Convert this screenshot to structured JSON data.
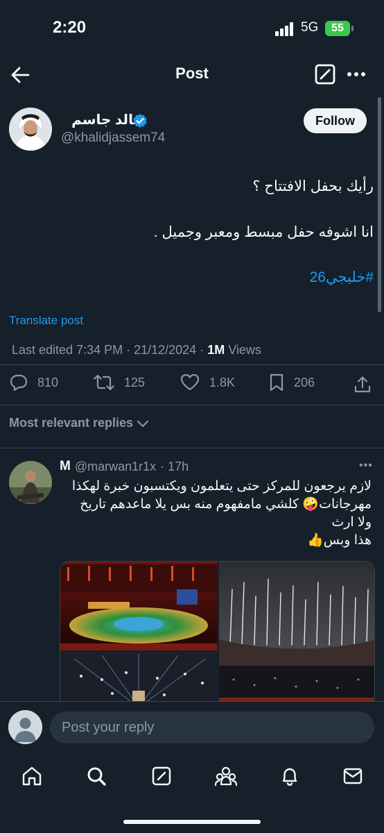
{
  "status": {
    "time": "2:20",
    "network": "5G",
    "battery": "55"
  },
  "header": {
    "title": "Post"
  },
  "author": {
    "name": "خالد جاسم",
    "handle": "@khalidjassem74",
    "follow_label": "Follow"
  },
  "post": {
    "line1": "رأيك بحفل الافتتاح ؟",
    "line2": "انا اشوفه حفل مبسط ومعبر وجميل .",
    "hashtag": "#خليجي26",
    "translate_label": "Translate post",
    "edited": "Last edited 7:34 PM · 21/12/2024 · ",
    "views_count": "1M",
    "views_label": " Views"
  },
  "actions": {
    "replies": "810",
    "reposts": "125",
    "likes": "1.8K",
    "bookmarks": "206"
  },
  "replies_filter": "Most relevant replies",
  "reply": {
    "name": "M",
    "handle": "@marwan1r1x",
    "time": "· 17h",
    "line1": "لازم يرجعون للمركز حتى يتعلمون ويكتسبون خبرة لهكذا",
    "line2": "مهرجانات🤪 كلشي مامفهوم منه بس يلا ماعدهم تاريخ",
    "line3": "ولا ارث",
    "line4": "هذا وبس👍"
  },
  "composer": {
    "placeholder": "Post your reply"
  },
  "colors": {
    "background": "#15202b",
    "accent": "#1d9bf0",
    "muted": "#8b98a5"
  }
}
